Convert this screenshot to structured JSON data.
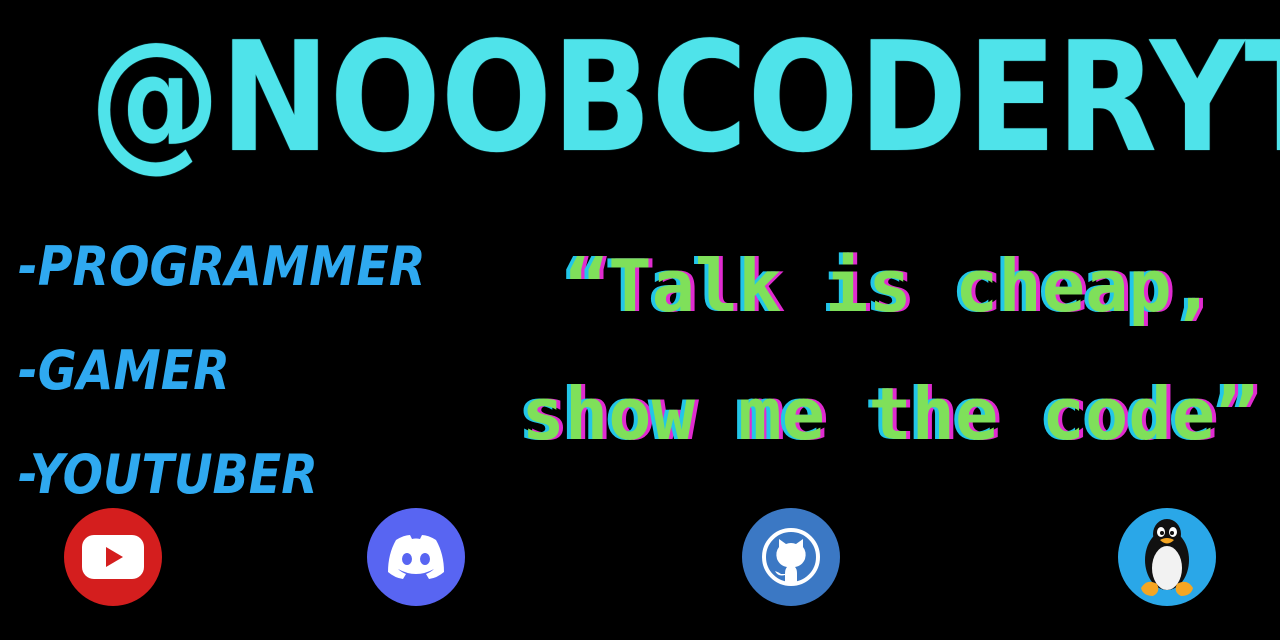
{
  "header": {
    "handle": "@NOOBCODERYT"
  },
  "roles": [
    {
      "label": "-PROGRAMMER"
    },
    {
      "label": "-GAMER"
    },
    {
      "label": "-YOUTUBER"
    }
  ],
  "quote": {
    "line1": "“Talk is cheap,",
    "line2": "show me the code”"
  },
  "socials": [
    {
      "icon": "youtube-icon",
      "color": "#d41e1e"
    },
    {
      "icon": "discord-icon",
      "color": "#5865f2"
    },
    {
      "icon": "github-icon",
      "color": "#3b78c4"
    },
    {
      "icon": "linux-tux-icon",
      "color": "#2aa7e8"
    }
  ],
  "colors": {
    "handle": "#4fe3ea",
    "roles": "#2fa9f0",
    "quote_fill": "#7fe05a",
    "quote_shadow_left": "#22c6e8",
    "quote_shadow_right": "#e02bd0",
    "background": "#000000"
  }
}
